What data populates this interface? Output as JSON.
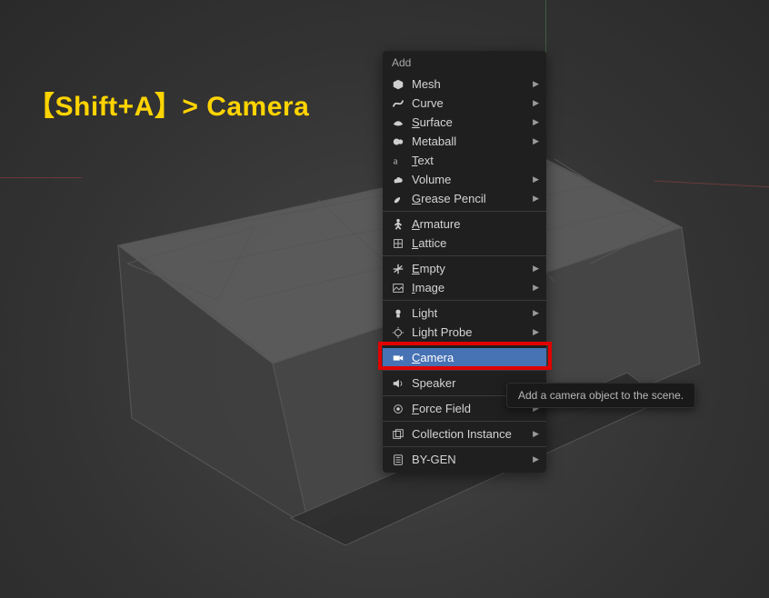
{
  "annotation": "【Shift+A】> Camera",
  "menu": {
    "title": "Add",
    "sections": [
      [
        {
          "icon": "mesh",
          "label": "Mesh",
          "hotkey_index": null,
          "submenu": true
        },
        {
          "icon": "curve",
          "label": "Curve",
          "hotkey_index": null,
          "submenu": true
        },
        {
          "icon": "surface",
          "label": "Surface",
          "hotkey_index": 0,
          "submenu": true
        },
        {
          "icon": "metaball",
          "label": "Metaball",
          "hotkey_index": null,
          "submenu": true
        },
        {
          "icon": "text",
          "label": "Text",
          "hotkey_index": 0,
          "submenu": false
        },
        {
          "icon": "volume",
          "label": "Volume",
          "hotkey_index": null,
          "submenu": true
        },
        {
          "icon": "grease",
          "label": "Grease Pencil",
          "hotkey_index": 0,
          "submenu": true
        }
      ],
      [
        {
          "icon": "armature",
          "label": "Armature",
          "hotkey_index": 0,
          "submenu": false
        },
        {
          "icon": "lattice",
          "label": "Lattice",
          "hotkey_index": 0,
          "submenu": false
        }
      ],
      [
        {
          "icon": "empty",
          "label": "Empty",
          "hotkey_index": 0,
          "submenu": true
        },
        {
          "icon": "image",
          "label": "Image",
          "hotkey_index": 0,
          "submenu": true
        }
      ],
      [
        {
          "icon": "light",
          "label": "Light",
          "hotkey_index": null,
          "submenu": true
        },
        {
          "icon": "lightprobe",
          "label": "Light Probe",
          "hotkey_index": null,
          "submenu": true
        }
      ],
      [
        {
          "icon": "camera",
          "label": "Camera",
          "hotkey_index": 0,
          "submenu": false,
          "highlighted": true
        }
      ],
      [
        {
          "icon": "speaker",
          "label": "Speaker",
          "hotkey_index": null,
          "submenu": false
        }
      ],
      [
        {
          "icon": "forcefield",
          "label": "Force Field",
          "hotkey_index": 0,
          "submenu": true
        }
      ],
      [
        {
          "icon": "collection",
          "label": "Collection Instance",
          "hotkey_index": null,
          "submenu": true
        }
      ],
      [
        {
          "icon": "bygen",
          "label": "BY-GEN",
          "hotkey_index": null,
          "submenu": true
        }
      ]
    ]
  },
  "tooltip": "Add a camera object to the scene."
}
